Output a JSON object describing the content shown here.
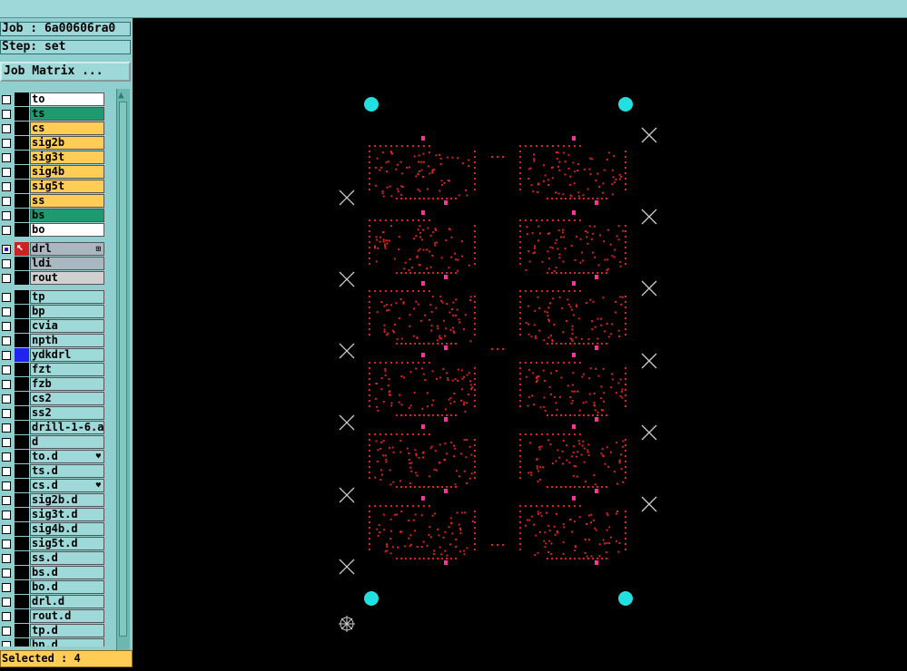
{
  "header": {
    "job_label": "Job : 6a00606ra0",
    "step_label": "Step: set"
  },
  "toolbar": {
    "job_matrix_label": "Job Matrix ..."
  },
  "layers": [
    {
      "name": "to",
      "color": "#ffffff"
    },
    {
      "name": "ts",
      "color": "#1f9a70"
    },
    {
      "name": "cs",
      "color": "#ffcc55"
    },
    {
      "name": "sig2b",
      "color": "#ffcc55"
    },
    {
      "name": "sig3t",
      "color": "#ffcc55"
    },
    {
      "name": "sig4b",
      "color": "#ffcc55"
    },
    {
      "name": "sig5t",
      "color": "#ffcc55"
    },
    {
      "name": "ss",
      "color": "#ffcc55"
    },
    {
      "name": "bs",
      "color": "#1f9a70"
    },
    {
      "name": "bo",
      "color": "#ffffff"
    },
    {
      "name": "drl",
      "color": "#a9b8c0",
      "checked": true,
      "indicator": "red",
      "mark": "⊞",
      "gap_before": true
    },
    {
      "name": "ldi",
      "color": "#a9b8c0"
    },
    {
      "name": "rout",
      "color": "#d0d0d0"
    },
    {
      "name": "tp",
      "color": "#9fd8d8",
      "gap_before": true
    },
    {
      "name": "bp",
      "color": "#9fd8d8"
    },
    {
      "name": "cvia",
      "color": "#9fd8d8"
    },
    {
      "name": "npth",
      "color": "#9fd8d8"
    },
    {
      "name": "ydkdrl",
      "color": "#9fd8d8",
      "indicator": "blue"
    },
    {
      "name": "fzt",
      "color": "#9fd8d8"
    },
    {
      "name": "fzb",
      "color": "#9fd8d8"
    },
    {
      "name": "cs2",
      "color": "#9fd8d8"
    },
    {
      "name": "ss2",
      "color": "#9fd8d8"
    },
    {
      "name": "drill-1-6.a",
      "color": "#9fd8d8"
    },
    {
      "name": "d",
      "color": "#9fd8d8"
    },
    {
      "name": "to.d",
      "color": "#9fd8d8",
      "mark": "♥"
    },
    {
      "name": "ts.d",
      "color": "#9fd8d8"
    },
    {
      "name": "cs.d",
      "color": "#9fd8d8",
      "mark": "♥"
    },
    {
      "name": "sig2b.d",
      "color": "#9fd8d8"
    },
    {
      "name": "sig3t.d",
      "color": "#9fd8d8"
    },
    {
      "name": "sig4b.d",
      "color": "#9fd8d8"
    },
    {
      "name": "sig5t.d",
      "color": "#9fd8d8"
    },
    {
      "name": "ss.d",
      "color": "#9fd8d8"
    },
    {
      "name": "bs.d",
      "color": "#9fd8d8"
    },
    {
      "name": "bo.d",
      "color": "#9fd8d8"
    },
    {
      "name": "drl.d",
      "color": "#9fd8d8"
    },
    {
      "name": "rout.d",
      "color": "#9fd8d8"
    },
    {
      "name": "tp.d",
      "color": "#9fd8d8"
    },
    {
      "name": "bp.d",
      "color": "#9fd8d8"
    }
  ],
  "status": {
    "selected_label": "Selected : 4"
  },
  "colors": {
    "canvas_bg": "#000000",
    "fiducial": "#22e0e0",
    "drill_hole": "#dd2222",
    "pad": "#ff3399",
    "cross_marker": "#cccccc"
  }
}
